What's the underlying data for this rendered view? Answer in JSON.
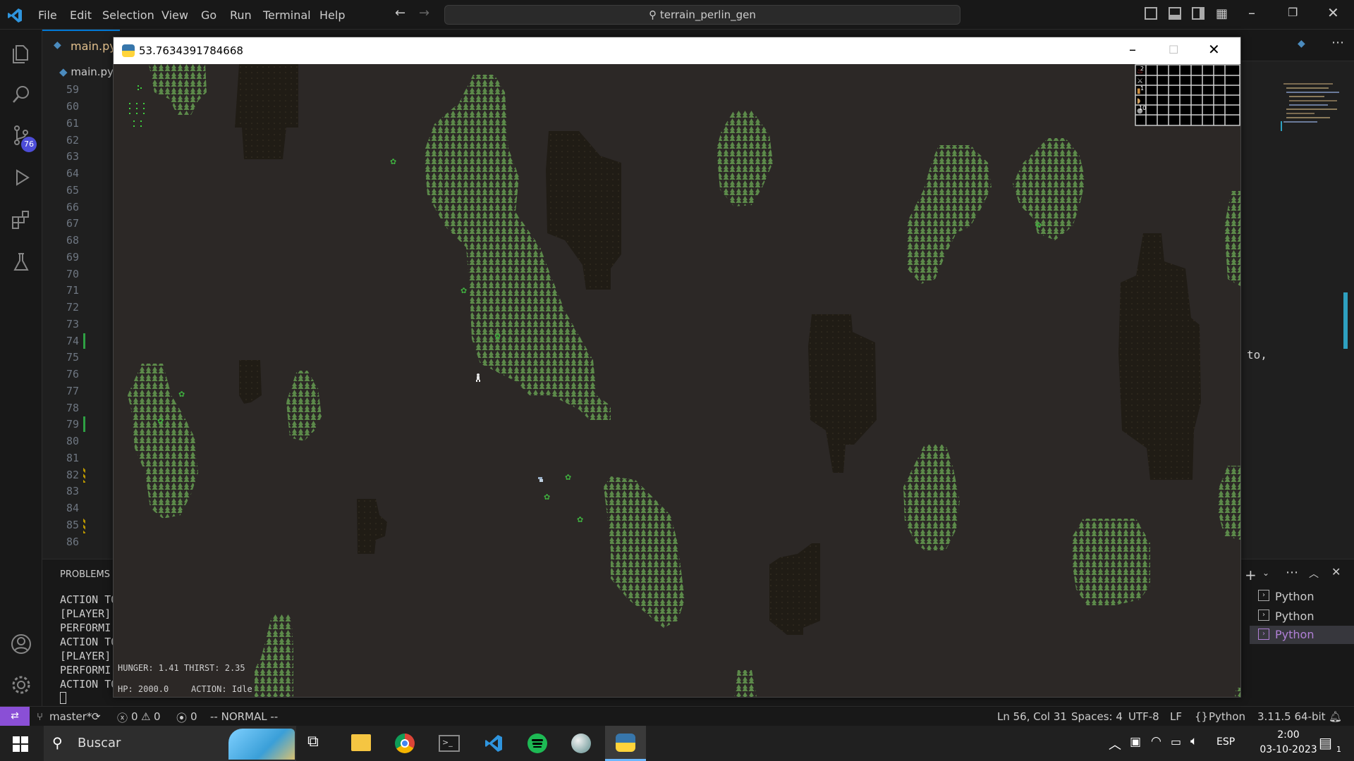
{
  "vscode": {
    "menu": [
      "File",
      "Edit",
      "Selection",
      "View",
      "Go",
      "Run",
      "Terminal",
      "Help"
    ],
    "search": "terrain_perlin_gen",
    "tab": "main.py",
    "breadcrumb": "main.py",
    "source_control_badge": "76",
    "line_numbers": [
      "59",
      "60",
      "61",
      "62",
      "63",
      "64",
      "65",
      "66",
      "67",
      "68",
      "69",
      "70",
      "71",
      "72",
      "73",
      "74",
      "75",
      "76",
      "77",
      "78",
      "79",
      "80",
      "81",
      "82",
      "83",
      "84",
      "85",
      "86"
    ],
    "code_fragment": "to,",
    "panel": {
      "tab": "PROBLEMS",
      "lines": [
        "ACTION TO",
        "[PLAYER]",
        "PERFORMI",
        "ACTION TO",
        "[PLAYER]",
        "PERFORMI",
        "ACTION TO"
      ]
    },
    "terminals": [
      "Python",
      "Python",
      "Python"
    ]
  },
  "status": {
    "branch": "master*",
    "errors": "0",
    "warnings": "0",
    "ports": "0",
    "mode": "-- NORMAL --",
    "position": "Ln 56, Col 31",
    "spaces": "Spaces: 4",
    "encoding": "UTF-8",
    "eol": "LF",
    "language": "Python",
    "interpreter": "3.11.5 64-bit"
  },
  "game": {
    "title": "53.7634391784668",
    "hunger_thirst": "HUNGER: 1.41 THIRST: 2.35",
    "hp": "HP: 2000.0",
    "action": "ACTION: Idle",
    "inventory_counts": [
      "2",
      "",
      "1",
      "",
      "10"
    ],
    "colors": {
      "tree": "#5c8a4a",
      "ground": "#2c2826",
      "mud": "#201c15",
      "hud_text": "#cfcfcf"
    }
  },
  "taskbar": {
    "search": "Buscar",
    "lang": "ESP",
    "time": "2:00",
    "date": "03-10-2023",
    "notifications": "1"
  }
}
